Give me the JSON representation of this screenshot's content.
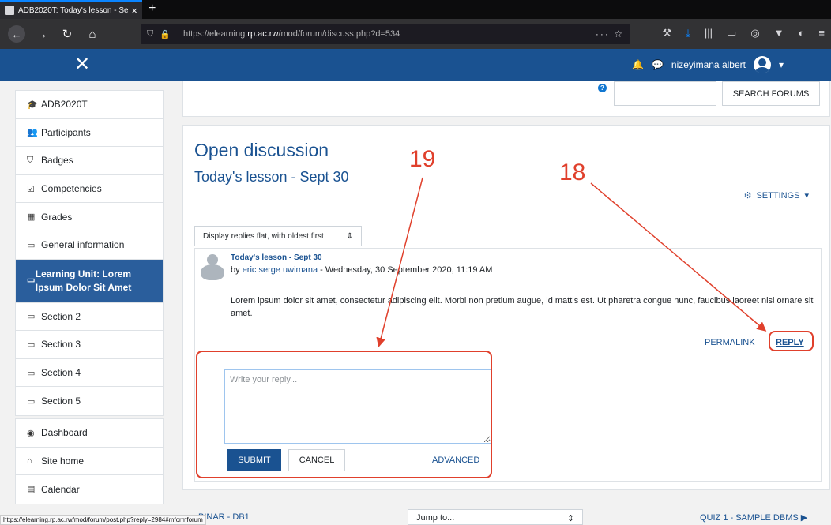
{
  "browser": {
    "tab_title": "ADB2020T: Today's lesson - Se",
    "tab_close": "×",
    "new_tab": "+",
    "url_prefix": "https://elearning.",
    "url_domain": "rp.ac.rw",
    "url_path": "/mod/forum/discuss.php?d=534",
    "url_tail": "··· ☆",
    "status_url": "https://elearning.rp.ac.rw/mod/forum/post.php?reply=2984#mformforum"
  },
  "header": {
    "close_glyph": "✕",
    "user_name": "nizeyimana albert"
  },
  "drawer": {
    "course_items": [
      {
        "label": "ADB2020T",
        "icon": "graduation-cap-icon",
        "glyph": "🎓"
      },
      {
        "label": "Participants",
        "icon": "users-icon",
        "glyph": "👥"
      },
      {
        "label": "Badges",
        "icon": "badge-icon",
        "glyph": "⛉"
      },
      {
        "label": "Competencies",
        "icon": "checkbox-icon",
        "glyph": "☑"
      },
      {
        "label": "Grades",
        "icon": "table-icon",
        "glyph": "▦"
      },
      {
        "label": "General information",
        "icon": "folder-icon",
        "glyph": "▭"
      },
      {
        "label": "Learning Unit: Lorem Ipsum Dolor Sit Amet",
        "icon": "folder-icon",
        "glyph": "▭"
      },
      {
        "label": "Section 2",
        "icon": "folder-icon",
        "glyph": "▭"
      },
      {
        "label": "Section 3",
        "icon": "folder-icon",
        "glyph": "▭"
      },
      {
        "label": "Section 4",
        "icon": "folder-icon",
        "glyph": "▭"
      },
      {
        "label": "Section 5",
        "icon": "folder-icon",
        "glyph": "▭"
      }
    ],
    "site_items": [
      {
        "label": "Dashboard",
        "icon": "dashboard-icon",
        "glyph": "◉"
      },
      {
        "label": "Site home",
        "icon": "home-icon",
        "glyph": "⌂"
      },
      {
        "label": "Calendar",
        "icon": "calendar-icon",
        "glyph": "▤"
      }
    ]
  },
  "search": {
    "button_label": "Search forums",
    "help_glyph": "?"
  },
  "forum": {
    "title": "Open discussion",
    "discussion_title": "Today's lesson - Sept 30",
    "settings_label": "Settings",
    "display_mode": "Display replies flat, with oldest first",
    "post": {
      "subject": "Today's lesson - Sept 30",
      "by": "by ",
      "author": "eric serge uwimana",
      "date": " - Wednesday, 30 September 2020, 11:19 AM",
      "text": "Lorem ipsum dolor sit amet, consectetur adipiscing elit. Morbi non pretium augue, id mattis est. Ut pharetra congue nunc, faucibus laoreet nisi ornare sit amet.",
      "permalink": "Permalink",
      "reply": "Reply"
    },
    "reply_form": {
      "placeholder": "Write your reply...",
      "submit": "Submit",
      "cancel": "Cancel",
      "advanced": "Advanced"
    }
  },
  "bottom_nav": {
    "prev": "BINAR - DB1",
    "jump": "Jump to...",
    "next": "Quiz 1 - SAMPLE DBMS ▶"
  },
  "annotations": {
    "label_18": "18",
    "label_19": "19",
    "color": "#e0402c"
  },
  "colors": {
    "brand": "#1a5291",
    "active_item": "#2a5e9c"
  }
}
